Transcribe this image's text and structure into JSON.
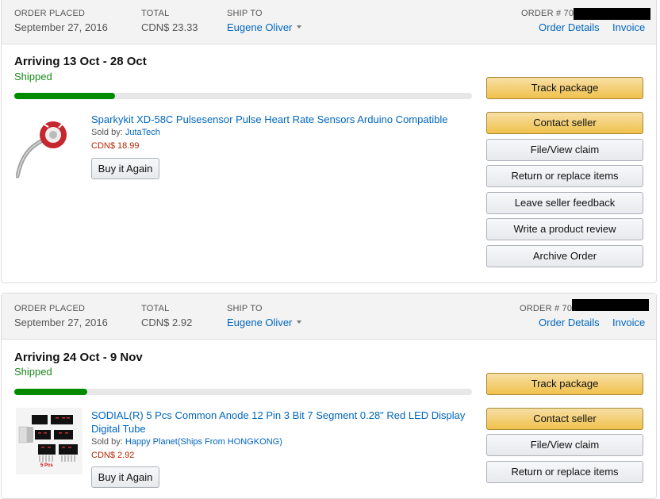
{
  "labels": {
    "order_placed": "ORDER PLACED",
    "total": "TOTAL",
    "ship_to": "SHIP TO",
    "order_number": "ORDER # 702",
    "order_details": "Order Details",
    "invoice": "Invoice",
    "sold_by": "Sold by:",
    "buy_again": "Buy it Again"
  },
  "colors": {
    "progress": "#008a00",
    "yellow_button": "#f0c14b",
    "link": "#0066c0",
    "price": "#b12704",
    "shipped": "#1a8a1a"
  },
  "orders": [
    {
      "date": "September 27, 2016",
      "total": "CDN$ 23.33",
      "ship_to": "Eugene Oliver",
      "arriving": "Arriving 13 Oct - 28 Oct",
      "status": "Shipped",
      "progress": 0.22,
      "item": {
        "title": "Sparkykit XD-58C Pulsesensor Pulse Heart Rate Sensors Arduino Compatible",
        "seller": "JutaTech",
        "price": "CDN$ 18.99",
        "image_icon": "pulse-sensor-icon"
      },
      "actions": [
        "Track package",
        "Contact seller",
        "File/View claim",
        "Return or replace items",
        "Leave seller feedback",
        "Write a product review",
        "Archive Order"
      ]
    },
    {
      "date": "September 27, 2016",
      "total": "CDN$ 2.92",
      "ship_to": "Eugene Oliver",
      "arriving": "Arriving 24 Oct - 9 Nov",
      "status": "Shipped",
      "progress": 0.16,
      "item": {
        "title": "SODIAL(R) 5 Pcs Common Anode 12 Pin 3 Bit 7 Segment 0.28\" Red LED Display Digital Tube",
        "seller": "Happy Planet(Ships From HONGKONG)",
        "price": "CDN$ 2.92",
        "image_icon": "led-display-icon",
        "image_caption": "5 Pcs"
      },
      "actions": [
        "Track package",
        "Contact seller",
        "File/View claim",
        "Return or replace items"
      ]
    }
  ]
}
